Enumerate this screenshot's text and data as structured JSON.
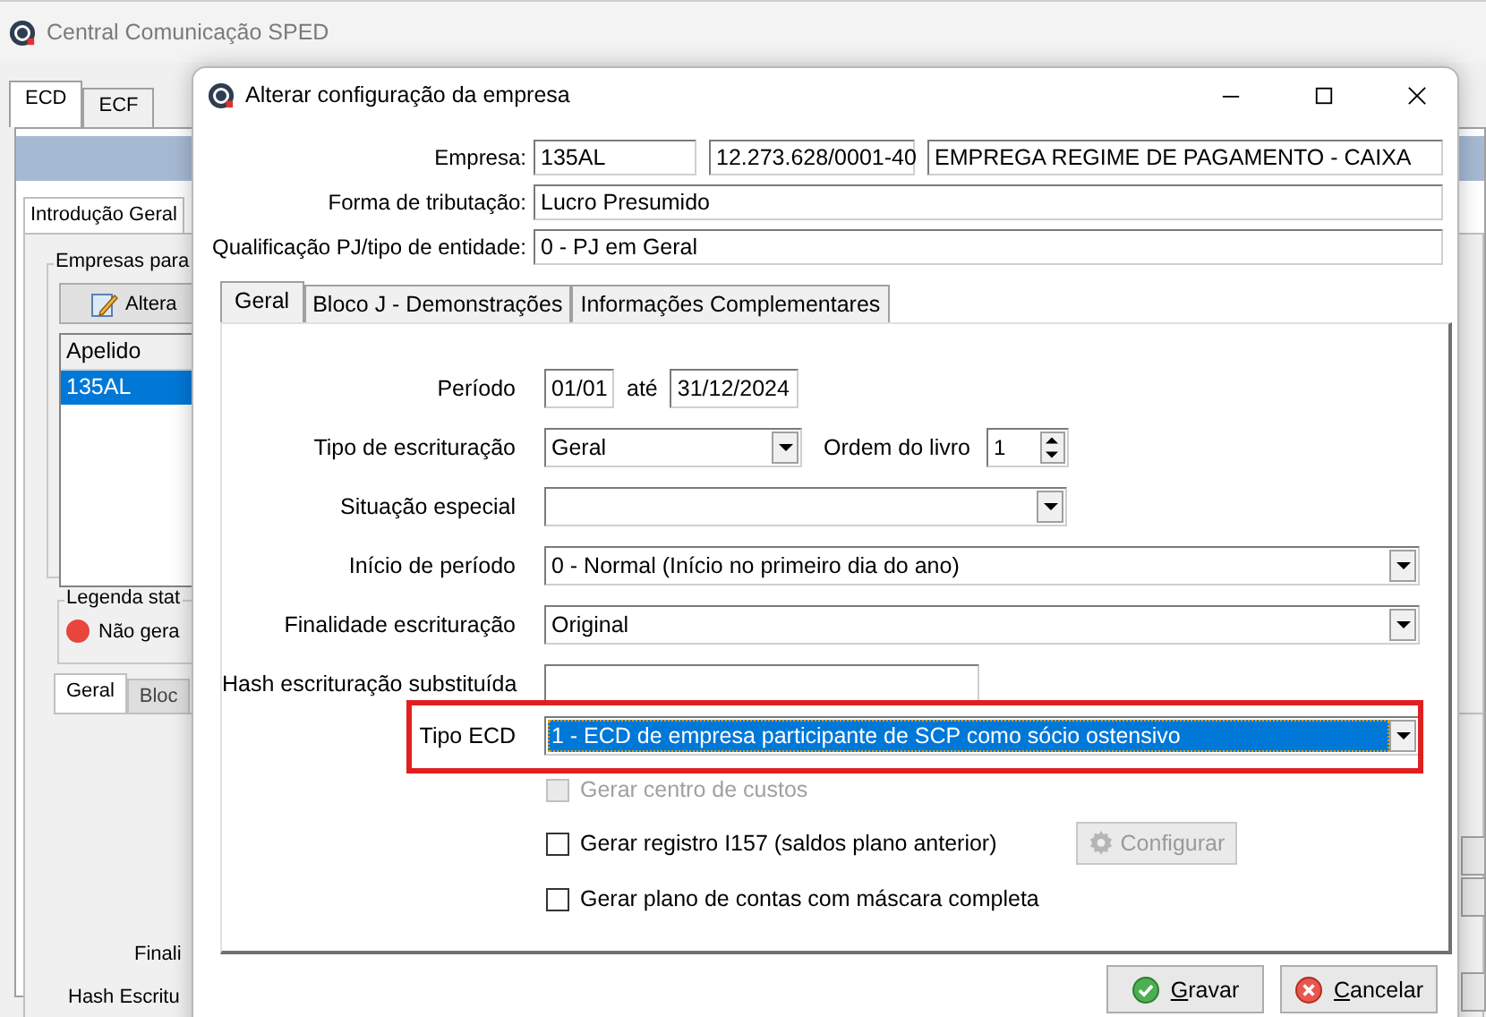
{
  "background_window": {
    "title": "Central Comunicação SPED",
    "tabs": [
      {
        "label": "ECD",
        "selected": true
      },
      {
        "label": "ECF",
        "selected": false
      }
    ],
    "subtabs": [
      {
        "label": "Introdução Geral",
        "selected": true
      }
    ],
    "group_title": "Empresas para",
    "edit_button": "Altera",
    "list": {
      "columns": [
        "Apelido"
      ],
      "rows": [
        {
          "cells": [
            "135AL"
          ],
          "selected": true
        }
      ]
    },
    "legend": {
      "title": "Legenda stat",
      "items": [
        {
          "label": "Não gera",
          "color": "#e8453c"
        }
      ]
    },
    "lower_tabs": [
      {
        "label": "Geral",
        "selected": true
      },
      {
        "label": "Bloc",
        "selected": false
      }
    ],
    "labels": [
      "Finali",
      "Hash Escritu"
    ]
  },
  "dialog": {
    "title": "Alterar configuração da empresa",
    "header_fields": [
      {
        "label": "Empresa:",
        "values": [
          "135AL",
          "12.273.628/0001-40",
          "EMPREGA REGIME DE PAGAMENTO - CAIXA"
        ]
      },
      {
        "label": "Forma de tributação:",
        "values": [
          "Lucro Presumido"
        ]
      },
      {
        "label": "Qualificação PJ/tipo de entidade:",
        "values": [
          "0 - PJ em Geral"
        ]
      }
    ],
    "tabs": [
      {
        "label": "Geral",
        "selected": true
      },
      {
        "label": "Bloco J - Demonstrações",
        "selected": false
      },
      {
        "label": "Informações Complementares",
        "selected": false
      }
    ],
    "rows": [
      {
        "kind": "period",
        "label": "Período",
        "from": "01/01",
        "separator": "até",
        "to": "31/12/2024"
      },
      {
        "kind": "combo_order",
        "label": "Tipo de escrituração",
        "value": "Geral",
        "order_label": "Ordem do livro",
        "order_value": "1"
      },
      {
        "kind": "combo",
        "label": "Situação especial"
      },
      {
        "kind": "combo",
        "label": "Início de período",
        "value": "0 - Normal (Início no primeiro dia do ano)"
      },
      {
        "kind": "combo",
        "label": "Finalidade escrituração",
        "value": "Original"
      },
      {
        "kind": "text",
        "label": "Hash escrituração substituída"
      },
      {
        "kind": "combo",
        "label": "Tipo ECD",
        "value": "1 - ECD de empresa participante de SCP como sócio ostensivo",
        "selected": true,
        "highlighted": true
      }
    ],
    "checkboxes": [
      {
        "label": "Gerar centro de custos",
        "checked": false,
        "disabled": true
      },
      {
        "label": "Gerar registro I157 (saldos plano anterior)",
        "checked": false,
        "disabled": false,
        "button": {
          "label": "Configurar",
          "disabled": true
        }
      },
      {
        "label": "Gerar plano de contas com máscara completa",
        "checked": false,
        "disabled": false
      }
    ],
    "buttons": [
      {
        "label": "Gravar",
        "kind": "ok"
      },
      {
        "label": "Cancelar",
        "kind": "cancel"
      }
    ]
  }
}
